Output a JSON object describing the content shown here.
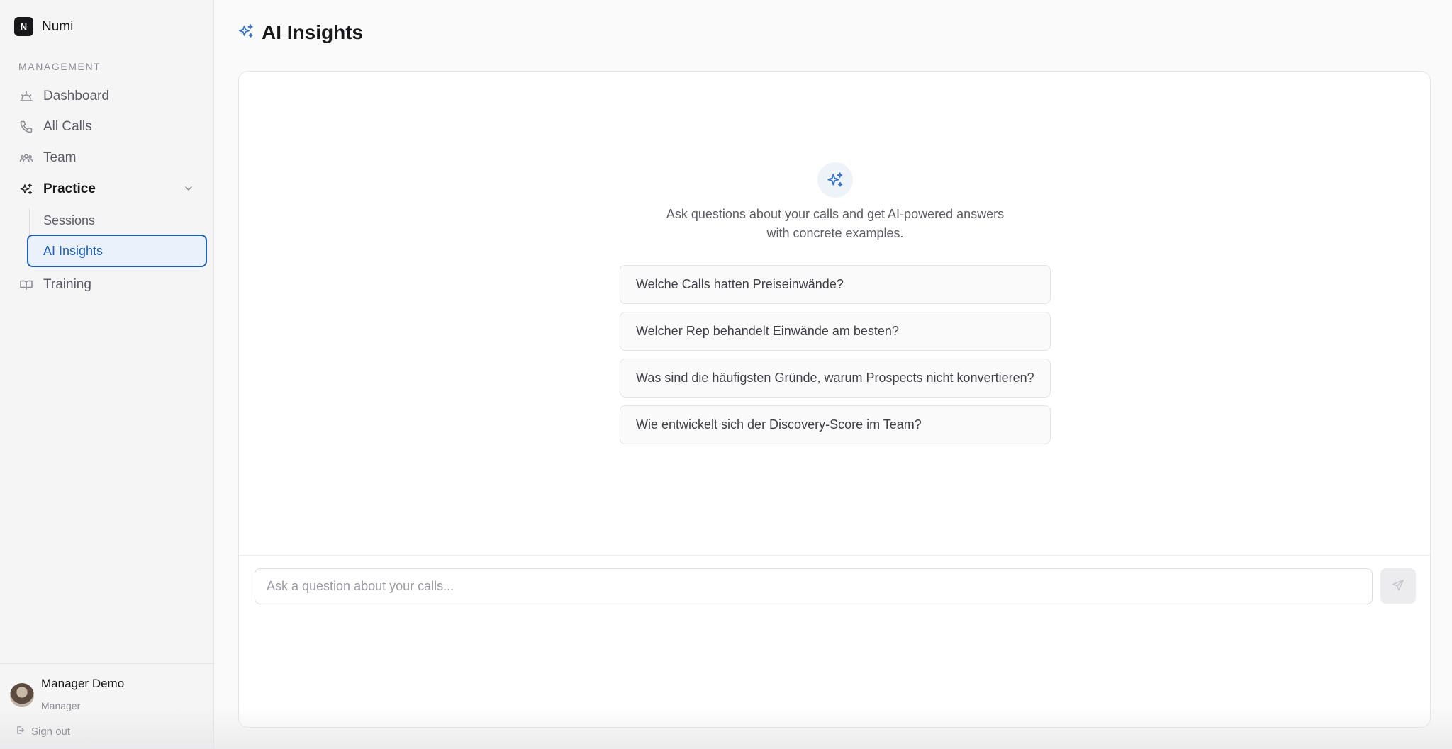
{
  "brand": {
    "logo_letter": "N",
    "name": "Numi"
  },
  "sidebar": {
    "section_label": "MANAGEMENT",
    "items": [
      {
        "label": "Dashboard",
        "icon": "sun-icon"
      },
      {
        "label": "All Calls",
        "icon": "phone-icon"
      },
      {
        "label": "Team",
        "icon": "users-icon"
      },
      {
        "label": "Practice",
        "icon": "sparkles-icon",
        "expanded": true,
        "children": [
          {
            "label": "Sessions",
            "active": false
          },
          {
            "label": "AI Insights",
            "active": true
          }
        ]
      },
      {
        "label": "Training",
        "icon": "book-icon"
      }
    ]
  },
  "user": {
    "name": "Manager Demo",
    "role": "Manager",
    "sign_out_label": "Sign out"
  },
  "page": {
    "title": "AI Insights"
  },
  "chat": {
    "intro_text": "Ask questions about your calls and get AI-powered answers with concrete examples.",
    "suggestions": [
      "Welche Calls hatten Preiseinwände?",
      "Welcher Rep behandelt Einwände am besten?",
      "Was sind die häufigsten Gründe, warum Prospects nicht konvertieren?",
      "Wie entwickelt sich der Discovery-Score im Team?"
    ],
    "input_placeholder": "Ask a question about your calls...",
    "input_value": ""
  },
  "colors": {
    "accent": "#1e5fb4",
    "sidebar_bg": "#f5f5f5",
    "page_bg": "#fafafa"
  }
}
